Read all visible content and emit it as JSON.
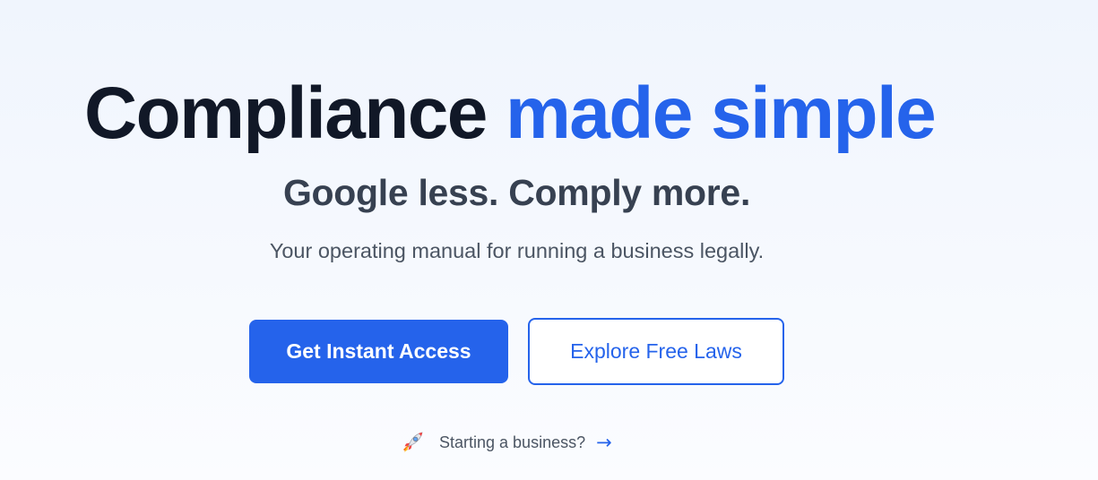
{
  "hero": {
    "headline_part1": "Compliance",
    "headline_part2": "made simple",
    "subheadline": "Google less. Comply more.",
    "tagline": "Your operating manual for running a business legally."
  },
  "buttons": {
    "primary_label": "Get Instant Access",
    "secondary_label": "Explore Free Laws"
  },
  "start_link": {
    "icon": "rocket-icon",
    "label": "Starting a business?",
    "arrow": "→",
    "arrow_icon": "arrow-right-icon"
  },
  "colors": {
    "accent": "#2563eb",
    "heading": "#111827",
    "subheading": "#374151",
    "body_text": "#4b5563",
    "background": "#f3f7fd"
  }
}
